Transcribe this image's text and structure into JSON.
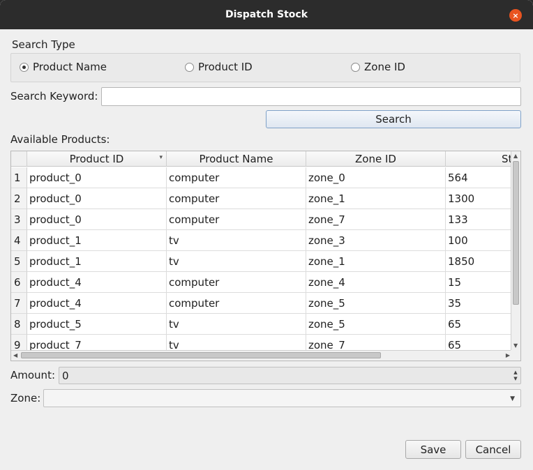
{
  "window": {
    "title": "Dispatch Stock",
    "close_icon": "×"
  },
  "search_type": {
    "label": "Search Type",
    "options": [
      {
        "label": "Product Name",
        "selected": true
      },
      {
        "label": "Product ID",
        "selected": false
      },
      {
        "label": "Zone ID",
        "selected": false
      }
    ]
  },
  "search": {
    "keyword_label": "Search Keyword:",
    "keyword_value": "",
    "button_label": "Search"
  },
  "products": {
    "label": "Available Products:",
    "columns": [
      "Product ID",
      "Product Name",
      "Zone ID",
      "St"
    ],
    "sort_indicator": "▾",
    "rows": [
      {
        "num": "1",
        "product_id": "product_0",
        "product_name": "computer",
        "zone_id": "zone_0",
        "stock": "564"
      },
      {
        "num": "2",
        "product_id": "product_0",
        "product_name": "computer",
        "zone_id": "zone_1",
        "stock": "1300"
      },
      {
        "num": "3",
        "product_id": "product_0",
        "product_name": "computer",
        "zone_id": "zone_7",
        "stock": "133"
      },
      {
        "num": "4",
        "product_id": "product_1",
        "product_name": "tv",
        "zone_id": "zone_3",
        "stock": "100"
      },
      {
        "num": "5",
        "product_id": "product_1",
        "product_name": "tv",
        "zone_id": "zone_1",
        "stock": "1850"
      },
      {
        "num": "6",
        "product_id": "product_4",
        "product_name": "computer",
        "zone_id": "zone_4",
        "stock": "15"
      },
      {
        "num": "7",
        "product_id": "product_4",
        "product_name": "computer",
        "zone_id": "zone_5",
        "stock": "35"
      },
      {
        "num": "8",
        "product_id": "product_5",
        "product_name": "tv",
        "zone_id": "zone_5",
        "stock": "65"
      },
      {
        "num": "9",
        "product_id": "product_7",
        "product_name": "tv",
        "zone_id": "zone_7",
        "stock": "65"
      }
    ]
  },
  "amount": {
    "label": "Amount:",
    "value": "0"
  },
  "zone": {
    "label": "Zone:",
    "value": ""
  },
  "buttons": {
    "save": "Save",
    "cancel": "Cancel"
  }
}
